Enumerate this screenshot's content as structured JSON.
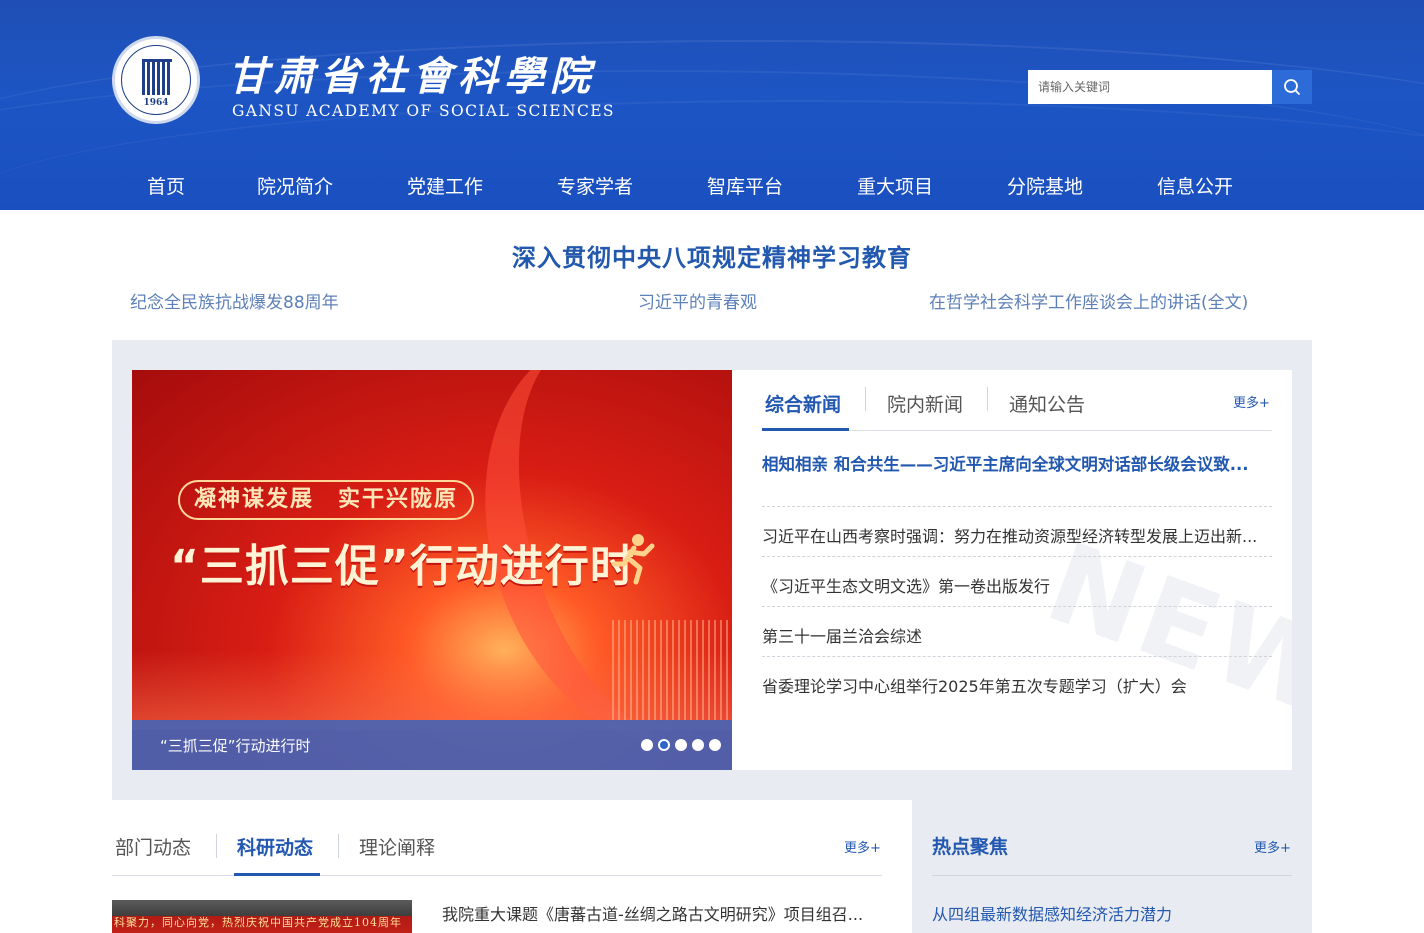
{
  "header": {
    "logo_year": "1964",
    "title": "甘肃省社會科學院",
    "subtitle": "GANSU ACADEMY OF SOCIAL SCIENCES",
    "search_placeholder": "请输入关键词",
    "nav": [
      "首页",
      "院况简介",
      "党建工作",
      "专家学者",
      "智库平台",
      "重大项目",
      "分院基地",
      "信息公开"
    ]
  },
  "headline": {
    "title": "深入贯彻中央八项规定精神学习教育",
    "links": [
      "纪念全民族抗战爆发88周年",
      "习近平的青春观",
      "在哲学社会科学工作座谈会上的讲话(全文)"
    ]
  },
  "slider": {
    "slogan_line1": "凝神谋发展　实干兴陇原",
    "slogan_line2": "“三抓三促”行动进行时",
    "caption": "“三抓三促”行动进行时",
    "dot_count": 5,
    "active_dot": 2
  },
  "news": {
    "tabs": [
      "综合新闻",
      "院内新闻",
      "通知公告"
    ],
    "active_tab": 0,
    "more": "更多+",
    "featured": "相知相亲 和合共生——习近平主席向全球文明对话部长级会议致...",
    "items": [
      "习近平在山西考察时强调：努力在推动资源型经济转型发展上迈出新...",
      "《习近平生态文明文选》第一卷出版发行",
      "第三十一届兰洽会综述",
      "省委理论学习中心组举行2025年第五次专题学习（扩大）会"
    ]
  },
  "dept": {
    "tabs": [
      "部门动态",
      "科研动态",
      "理论阐释"
    ],
    "active_tab": 1,
    "more": "更多+",
    "thumb_text": "科聚力，同心向党，热烈庆祝中国共产党成立104周年",
    "first_item": "我院重大课题《唐蕃古道-丝绸之路古文明研究》项目组召..."
  },
  "hot": {
    "title": "热点聚焦",
    "more": "更多+",
    "first_item": "从四组最新数据感知经济活力潜力"
  },
  "colors": {
    "header_blue": "#1d55c4",
    "accent_blue": "#2358b0",
    "panel_gray": "#e8ebf1"
  }
}
